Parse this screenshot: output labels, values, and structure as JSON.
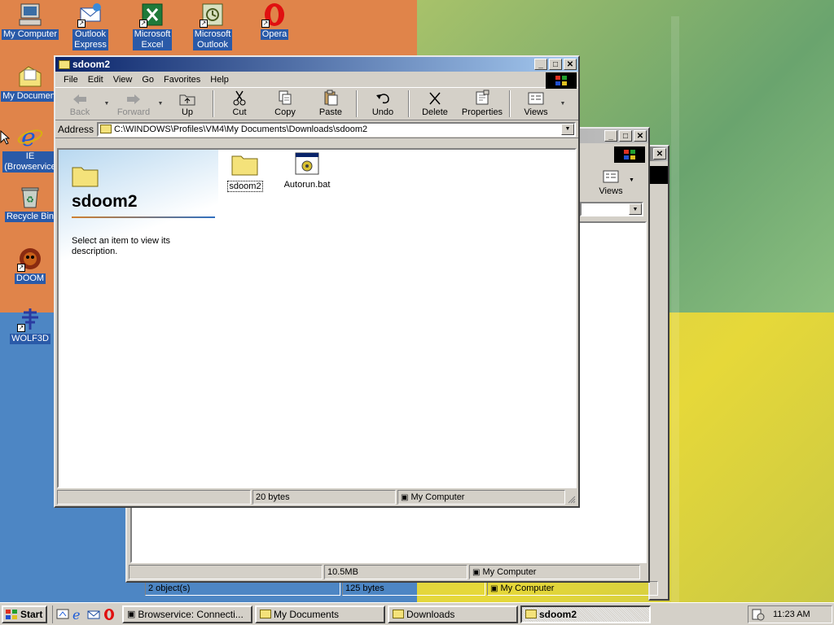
{
  "desktop": {
    "icons": [
      {
        "label": "My Computer"
      },
      {
        "label_line1": "Outlook",
        "label_line2": "Express"
      },
      {
        "label_line1": "Microsoft",
        "label_line2": "Excel"
      },
      {
        "label_line1": "Microsoft",
        "label_line2": "Outlook"
      },
      {
        "label": "Opera"
      },
      {
        "label": "My Document"
      },
      {
        "label_line1": "IE",
        "label_line2": "(Browservice"
      },
      {
        "label": "Recycle Bin"
      },
      {
        "label": "DOOM"
      },
      {
        "label": "WOLF3D"
      }
    ]
  },
  "back_window": {
    "views_label": "Views",
    "status": {
      "size": "10.5MB",
      "zone": "My Computer"
    }
  },
  "back_window2": {
    "status": {
      "objects": "2 object(s)",
      "size": "125 bytes",
      "zone": "My Computer"
    }
  },
  "main_window": {
    "title": "sdoom2",
    "menu": [
      "File",
      "Edit",
      "View",
      "Go",
      "Favorites",
      "Help"
    ],
    "toolbar": {
      "back": "Back",
      "forward": "Forward",
      "up": "Up",
      "cut": "Cut",
      "copy": "Copy",
      "paste": "Paste",
      "undo": "Undo",
      "delete": "Delete",
      "properties": "Properties",
      "views": "Views"
    },
    "address_label": "Address",
    "address_value": "C:\\WINDOWS\\Profiles\\VM4\\My Documents\\Downloads\\sdoom2",
    "webview": {
      "folder_title": "sdoom2",
      "description": "Select an item to view its description."
    },
    "files": [
      {
        "name": "sdoom2",
        "type": "folder"
      },
      {
        "name": "Autorun.bat",
        "type": "batch"
      }
    ],
    "status": {
      "left": "",
      "size": "20 bytes",
      "zone": "My Computer"
    }
  },
  "taskbar": {
    "start": "Start",
    "tasks": [
      "Browservice: Connecti...",
      "My Documents",
      "Downloads",
      "sdoom2"
    ],
    "clock": "11:23 AM"
  },
  "colors": {
    "titlebar_active": "#0a246a",
    "titlebar_inactive": "#808080",
    "chrome": "#d4d0c8",
    "icon_label_bg": "#2a5aa8"
  }
}
